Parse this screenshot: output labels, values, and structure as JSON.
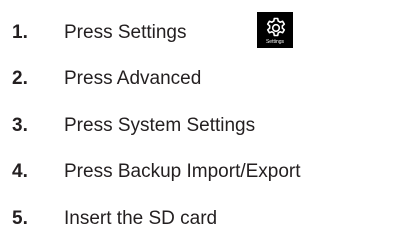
{
  "steps": [
    {
      "number": "1.",
      "text": "Press Settings"
    },
    {
      "number": "2.",
      "text": "Press Advanced"
    },
    {
      "number": "3.",
      "text": "Press System Settings"
    },
    {
      "number": "4.",
      "text": "Press Backup Import/Export"
    },
    {
      "number": "5.",
      "text": "Insert the SD card"
    }
  ],
  "settings_button": {
    "icon": "gear-icon",
    "caption": "Settings",
    "background": "#000000",
    "foreground": "#ffffff"
  }
}
